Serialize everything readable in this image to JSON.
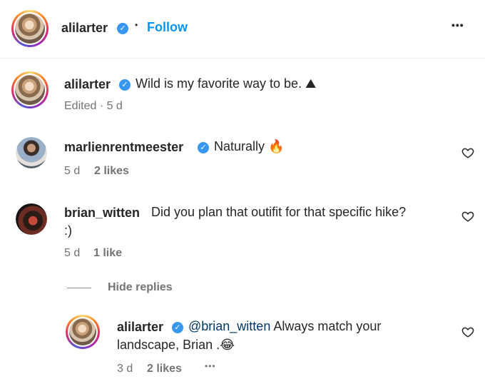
{
  "header": {
    "username": "alilarter",
    "separator": "•",
    "follow_label": "Follow",
    "more_label": "•••"
  },
  "caption": {
    "username": "alilarter",
    "text": "Wild is my favorite way to be.",
    "emoji": "⛰",
    "meta": "Edited · 5 d"
  },
  "comments": [
    {
      "username": "marlienrentmeester",
      "text": "Naturally",
      "emoji": "🔥",
      "time": "5 d",
      "likes": "2 likes"
    },
    {
      "username": "brian_witten",
      "text_line1": "Did you plan that outifit for that specific hike?",
      "text_line2": ":)",
      "time": "5 d",
      "likes": "1 like"
    }
  ],
  "hide_replies_label": "Hide replies",
  "reply": {
    "username": "alilarter",
    "mention": "@brian_witten",
    "text_line1": "Always match your",
    "text_line2": "landscape, Brian .",
    "emoji": "😂",
    "time": "3 d",
    "likes": "2 likes",
    "more_label": "•••"
  },
  "colors": {
    "accent": "#0095f6",
    "verified": "#3897f0",
    "muted": "#737373"
  }
}
